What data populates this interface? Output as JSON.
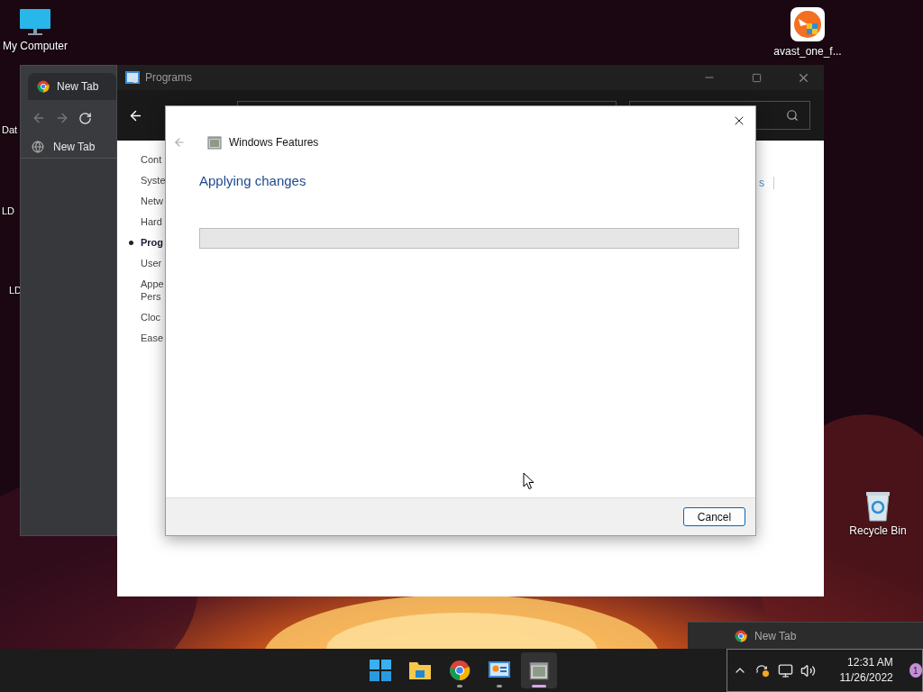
{
  "desktop_icons": [
    {
      "label": "My Computer",
      "kind": "monitor"
    },
    {
      "label": "Dat",
      "kind": "text"
    },
    {
      "label": "LD",
      "kind": "text"
    },
    {
      "label": "LD",
      "kind": "text"
    },
    {
      "label": "avast_one_f...",
      "kind": "app"
    },
    {
      "label": "Recycle Bin",
      "kind": "bin"
    }
  ],
  "browser": {
    "tab": "New Tab",
    "bookmark": "New Tab"
  },
  "programs_window": {
    "title": "Programs",
    "sidebar": [
      {
        "label": "Cont",
        "selected": false
      },
      {
        "label": "Syste",
        "selected": false
      },
      {
        "label": "Netw",
        "selected": false
      },
      {
        "label": "Hard",
        "selected": false
      },
      {
        "label": "Prog",
        "selected": true
      },
      {
        "label": "User",
        "selected": false
      },
      {
        "label": "Appe Pers",
        "selected": false
      },
      {
        "label": "Cloc",
        "selected": false
      },
      {
        "label": "Ease",
        "selected": false
      }
    ],
    "link_fragment": "s"
  },
  "dialog": {
    "title": "Windows Features",
    "heading": "Applying changes",
    "progress": {
      "level": 0
    },
    "cancel": "Cancel"
  },
  "taskbar": {
    "apps": [
      {
        "kind": "start",
        "running": false,
        "selected": false
      },
      {
        "kind": "explorer",
        "running": false,
        "selected": false
      },
      {
        "kind": "chrome",
        "running": true,
        "selected": false
      },
      {
        "kind": "control",
        "running": true,
        "selected": false
      },
      {
        "kind": "features",
        "running": true,
        "selected": true
      }
    ],
    "preview": {
      "title": "New Tab"
    },
    "tray": {
      "time": "12:31 AM",
      "date": "11/26/2022",
      "badge": "1"
    }
  }
}
